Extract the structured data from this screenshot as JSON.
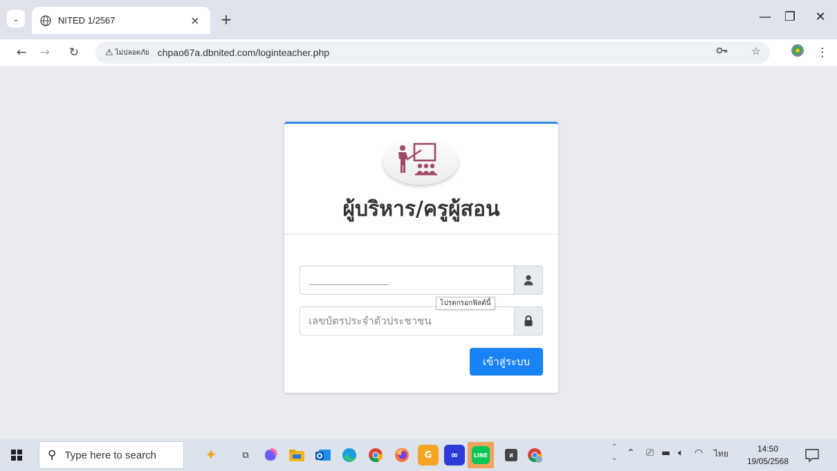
{
  "browser": {
    "tab_title": "NITED 1/2567",
    "tab_close": "×",
    "new_tab": "+",
    "security_label": "ไม่ปลอดภัย",
    "url": "chpao67a.dbnited.com/loginteacher.php"
  },
  "login": {
    "title": "ผู้บริหาร/ครูผู้สอน",
    "username_value": "",
    "password_placeholder": "เลขบัตรประจำตัวประชาชน",
    "tooltip": "โปรดกรอกฟิลด์นี้",
    "submit_label": "เข้าสู่ระบบ",
    "accent_color": "#1a82f7",
    "logo_color": "#a14a63"
  },
  "taskbar": {
    "search_placeholder": "Type here to search",
    "language": "ไทย",
    "time": "14:50",
    "date": "19/05/2568",
    "apps": [
      "copilot-icon",
      "file-explorer-icon",
      "outlook-icon",
      "edge-icon",
      "chrome-icon",
      "firefox-icon",
      "gdrive-app-icon",
      "canva-icon",
      "line-icon",
      "terminal-icon",
      "chrome-profile-icon"
    ]
  }
}
